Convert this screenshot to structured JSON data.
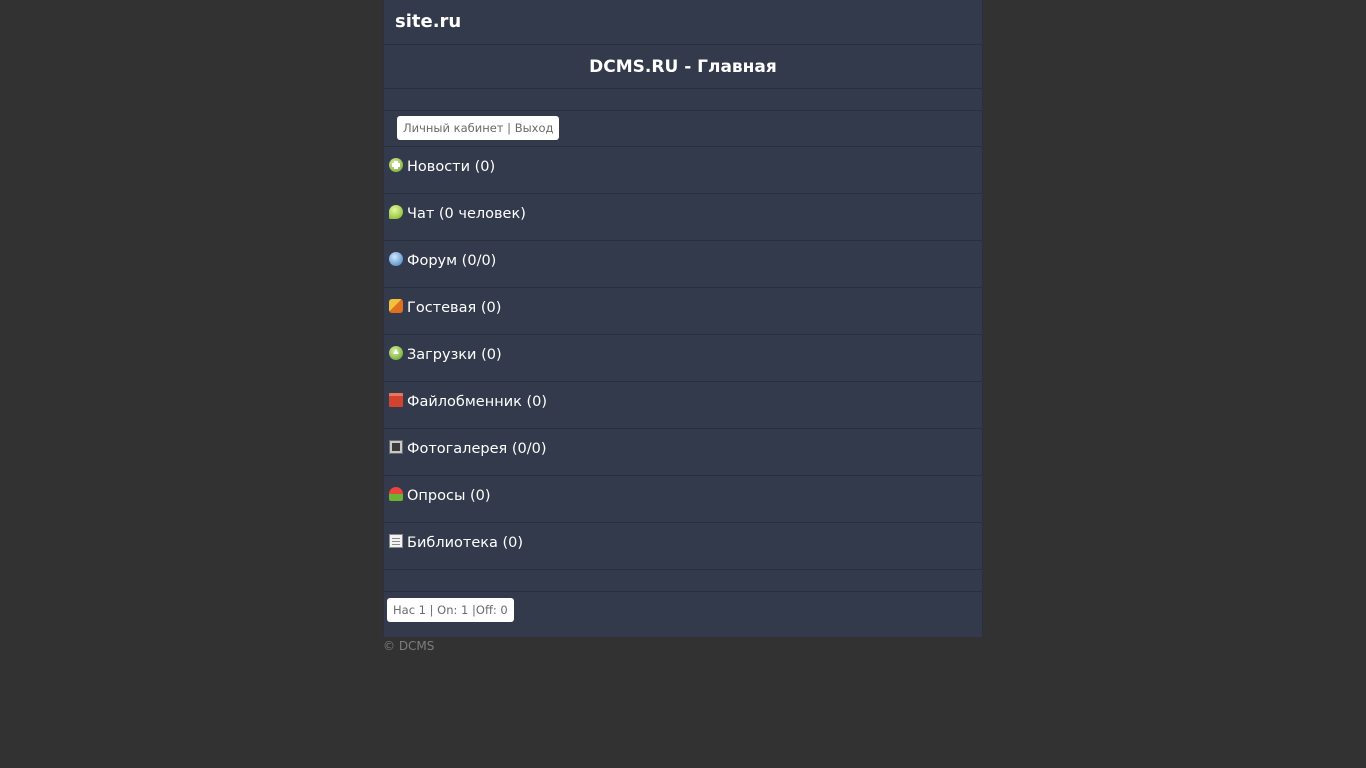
{
  "header": {
    "site_name": "site.ru",
    "page_title": "DCMS.RU - Главная"
  },
  "user_bar": {
    "cabinet_link": "Личный кабинет",
    "separator": "|",
    "logout_link": "Выход"
  },
  "menu": [
    {
      "label": "Новости (0)",
      "icon": "news-icon"
    },
    {
      "label": "Чат (0 человек)",
      "icon": "chat-icon"
    },
    {
      "label": "Форум (0/0)",
      "icon": "forum-icon"
    },
    {
      "label": "Гостевая (0)",
      "icon": "guestbook-icon"
    },
    {
      "label": "Загрузки (0)",
      "icon": "downloads-icon"
    },
    {
      "label": "Файлобменник (0)",
      "icon": "folder-icon"
    },
    {
      "label": "Фотогалерея (0/0)",
      "icon": "photo-icon"
    },
    {
      "label": "Опросы (0)",
      "icon": "poll-icon"
    },
    {
      "label": "Библиотека (0)",
      "icon": "library-icon"
    }
  ],
  "stats": {
    "text": "Нас 1 | On: 1 |Off: 0"
  },
  "footer": {
    "copyright": "© DCMS"
  },
  "colors": {
    "page_bg": "#323232",
    "panel_bg": "#333a4b",
    "text": "#ffffff",
    "muted": "#7d7d7d"
  }
}
